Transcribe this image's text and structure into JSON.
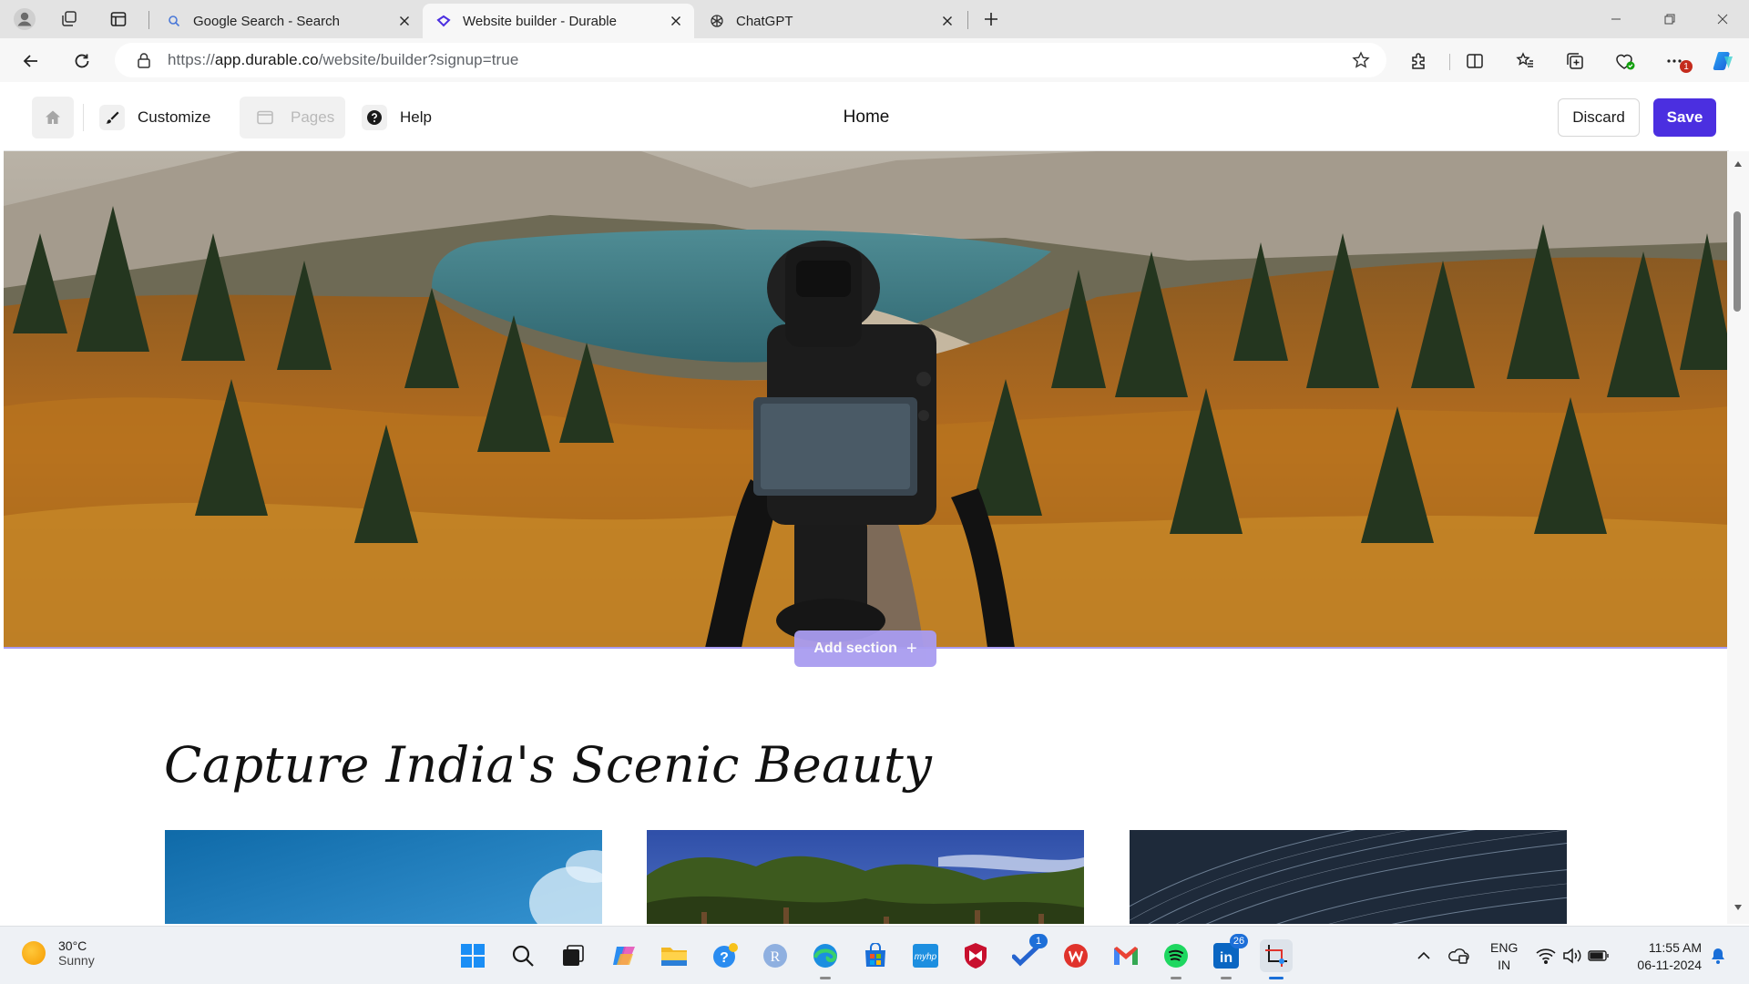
{
  "browser": {
    "tabs": [
      {
        "title": "Google Search - Search",
        "active": false
      },
      {
        "title": "Website builder - Durable",
        "active": true
      },
      {
        "title": "ChatGPT",
        "active": false
      }
    ],
    "url_prefix": "https://",
    "url_domain": "app.durable.co",
    "url_path": "/website/builder?signup=true",
    "notification_count": "1"
  },
  "builder": {
    "nav": {
      "customize": "Customize",
      "pages": "Pages",
      "help": "Help"
    },
    "page_title": "Home",
    "discard_label": "Discard",
    "save_label": "Save",
    "accent_color": "#4b2fe0"
  },
  "canvas": {
    "add_section_label": "Add section",
    "section_heading": "Capture India's Scenic Beauty"
  },
  "taskbar": {
    "weather_temp": "30°C",
    "weather_desc": "Sunny",
    "linkedin_badge": "26",
    "todo_badge": "1",
    "language": "ENG",
    "region": "IN",
    "time": "11:55 AM",
    "date": "06-11-2024"
  }
}
